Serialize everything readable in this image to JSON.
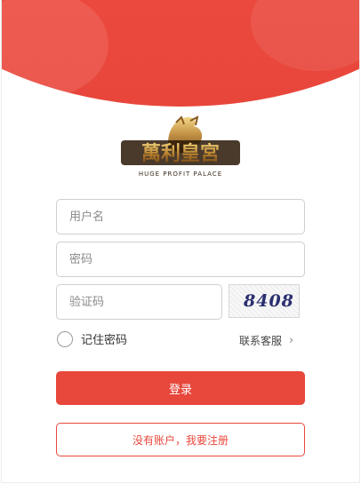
{
  "colors": {
    "accent": "#e8473c",
    "header": "#ec4a3f"
  },
  "logo": {
    "icon": "royal-palace-logo",
    "text": "萬利皇宮",
    "subtitle": "HUGE PROFIT PALACE"
  },
  "form": {
    "username_placeholder": "用户名",
    "password_placeholder": "密码",
    "captcha_placeholder": "验证码",
    "captcha_code": "8408",
    "remember_label": "记住密码",
    "remember_checked": false,
    "contact_label": "联系客服",
    "login_label": "登录",
    "register_label": "没有账户，我要注册"
  }
}
